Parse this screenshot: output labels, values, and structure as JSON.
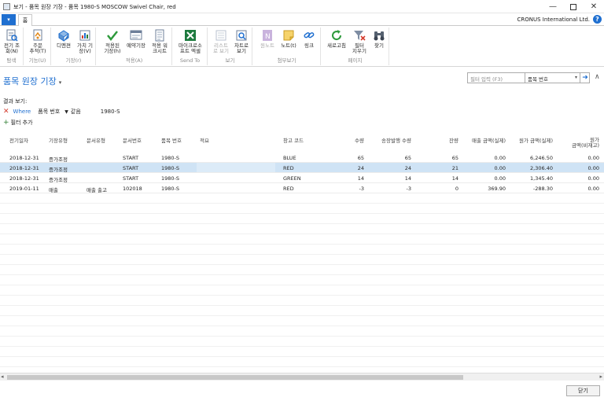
{
  "window": {
    "title": "보기 - 품목 원장 기장 - 품목 1980-S MOSCOW Swivel Chair, red",
    "company": "CRONUS International Ltd.",
    "tab_home": "홈",
    "help": "?"
  },
  "ribbon": {
    "groups": [
      {
        "label": "탐색",
        "buttons": [
          {
            "label": "전기 조\n회(N)",
            "icon": "navigate-icon"
          }
        ]
      },
      {
        "label": "기능(U)",
        "buttons": [
          {
            "label": "주문\n추적(T)",
            "icon": "order-tracking-icon"
          }
        ]
      },
      {
        "label": "기장(r)",
        "buttons": [
          {
            "label": "디멘젼",
            "icon": "dimensions-icon"
          },
          {
            "label": "가치 기\n장(V)",
            "icon": "value-entries-icon"
          }
        ]
      },
      {
        "label": "적용(A)",
        "buttons": [
          {
            "label": "적용된\n기장(h)",
            "icon": "applied-entries-icon"
          },
          {
            "label": "예약기장",
            "icon": "reservation-icon"
          },
          {
            "label": "적용 워\n크시트",
            "icon": "worksheet-icon"
          }
        ]
      },
      {
        "label": "Send To",
        "buttons": [
          {
            "label": "마이크로소\n프트 엑셀",
            "icon": "excel-icon"
          }
        ]
      },
      {
        "label": "보기",
        "buttons": [
          {
            "label": "리스트\n로 보기",
            "icon": "list-view-icon",
            "disabled": true
          },
          {
            "label": "차트로\n보기",
            "icon": "chart-view-icon"
          }
        ]
      },
      {
        "label": "첨부보기",
        "buttons": [
          {
            "label": "원노트",
            "icon": "onenote-icon",
            "disabled": true
          },
          {
            "label": "노트(t)",
            "icon": "note-icon"
          },
          {
            "label": "링크",
            "icon": "link-icon"
          }
        ]
      },
      {
        "label": "페이지",
        "buttons": [
          {
            "label": "새로고침",
            "icon": "refresh-icon"
          },
          {
            "label": "필터\n지우기",
            "icon": "clear-filter-icon"
          },
          {
            "label": "찾기",
            "icon": "binoculars-icon"
          }
        ]
      }
    ]
  },
  "page": {
    "title": "품목 원장 기장",
    "filter_placeholder": "필터 입력 (F3)",
    "filter_field": "품목 번호",
    "result_label": "결과 보기:",
    "where": "Where",
    "where_field": "품목 번호",
    "where_op": "같음",
    "where_value": "1980-S",
    "add_filter": "필터 추가",
    "close_button": "닫기"
  },
  "table": {
    "columns": [
      "전기일자",
      "기장유형",
      "문서유형",
      "문서번호",
      "품목 번호",
      "적요",
      "창고 코드",
      "수량",
      "송장발행 수량",
      "잔량",
      "매출 금액(실제)",
      "원가 금액(실제)",
      "원가\n금액(비재고)"
    ],
    "rows": [
      [
        "2018-12-31",
        "증가조정",
        "",
        "START",
        "1980-S",
        "",
        "BLUE",
        "65",
        "65",
        "65",
        "0.00",
        "6,246.50",
        "0.00"
      ],
      [
        "2018-12-31",
        "증가조정",
        "",
        "START",
        "1980-S",
        "",
        "RED",
        "24",
        "24",
        "21",
        "0.00",
        "2,306.40",
        "0.00"
      ],
      [
        "2018-12-31",
        "증가조정",
        "",
        "START",
        "1980-S",
        "",
        "GREEN",
        "14",
        "14",
        "14",
        "0.00",
        "1,345.40",
        "0.00"
      ],
      [
        "2019-01-11",
        "매출",
        "매출 출고",
        "102018",
        "1980-S",
        "",
        "RED",
        "-3",
        "-3",
        "0",
        "369.90",
        "-288.30",
        "0.00"
      ]
    ],
    "selected_row": 1
  }
}
